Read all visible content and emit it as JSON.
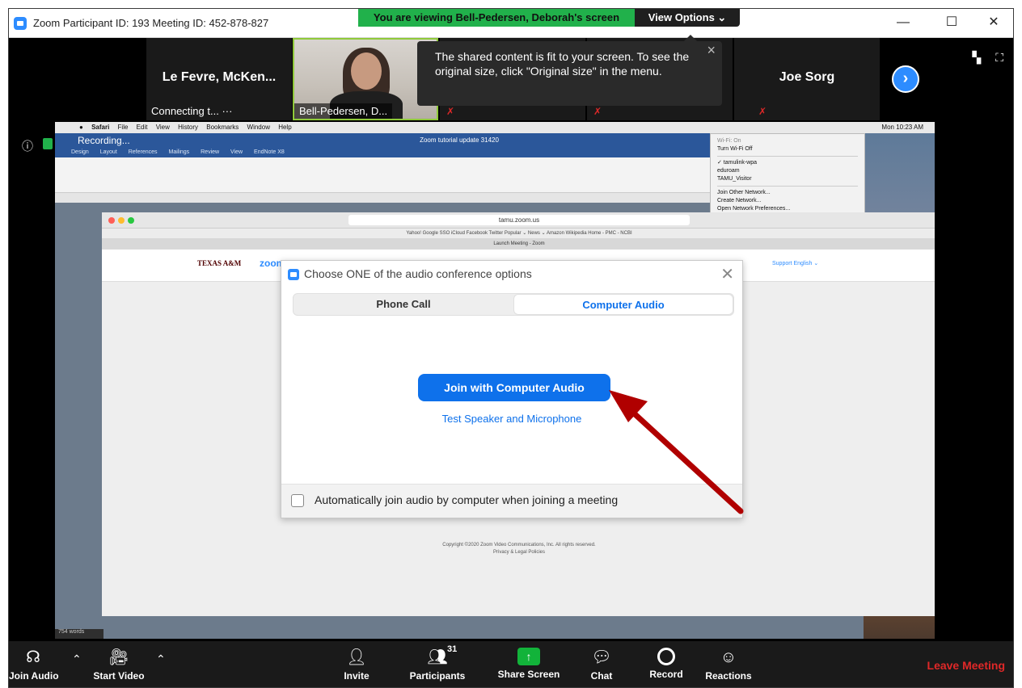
{
  "titlebar": {
    "title": "Zoom Participant ID: 193   Meeting ID: 452-878-827",
    "banner": "You are viewing Bell-Pedersen, Deborah's screen",
    "view_options": "View Options ⌄",
    "minimize": "—",
    "maximize": "☐",
    "close": "✕"
  },
  "strip": {
    "tile1_name": "Le Fevre, McKen...",
    "tile1_status": "Connecting t... ···",
    "tile2_label": "Bell-Pedersen, D...",
    "tile4_name": "Joe Sorg",
    "tooltip": "The shared content is fit to your screen. To see the original size, click \"Original size\" in the menu.",
    "next": "›"
  },
  "shared": {
    "recording": "Recording...",
    "mac_menu": [
      "Safari",
      "File",
      "Edit",
      "View",
      "History",
      "Bookmarks",
      "Window",
      "Help"
    ],
    "mac_time": "Mon 10:23 AM",
    "word_title": "Zoom tutorial update 31420",
    "word_tabs": [
      "Design",
      "Layout",
      "References",
      "Mailings",
      "Review",
      "View",
      "EndNote X8"
    ],
    "word_status": "754 words",
    "wifi": {
      "status": "Wi-Fi: On",
      "toggle": "Turn Wi-Fi Off",
      "networks": [
        "✓ tamulink-wpa",
        "eduroam",
        "TAMU_Visitor"
      ],
      "actions": [
        "Join Other Network...",
        "Create Network...",
        "Open Network Preferences..."
      ]
    },
    "url": "tamu.zoom.us",
    "bookmarks": "Yahoo!  Google  SSO  iCloud  Facebook  Twitter  Popular ⌄  News ⌄  Amazon  Wikipedia  Home - PMC - NCBI",
    "tab_title": "Launch Meeting - Zoom",
    "tamu_logo": "TEXAS A&M",
    "zoom_logo": "zoom",
    "page_links": "Support   English ⌄",
    "copyright_line1": "Copyright ©2020 Zoom Video Communications, Inc. All rights reserved.",
    "copyright_line2": "Privacy & Legal Policies"
  },
  "dialog": {
    "title": "Choose ONE of the audio conference options",
    "close": "✕",
    "tab_phone": "Phone Call",
    "tab_computer": "Computer Audio",
    "join_button": "Join with Computer Audio",
    "test_link": "Test Speaker and Microphone",
    "auto_join_label": "Automatically join audio by computer when joining a meeting"
  },
  "controls": {
    "join_audio": "Join Audio",
    "start_video": "Start Video",
    "invite": "Invite",
    "participants": "Participants",
    "participants_count": "31",
    "share_screen": "Share Screen",
    "chat": "Chat",
    "record": "Record",
    "reactions": "Reactions",
    "leave": "Leave Meeting"
  },
  "colors": {
    "zoom_blue": "#0e71eb",
    "banner_green": "#21b14b",
    "leave_red": "#e02828",
    "annotation_arrow": "#b00000"
  }
}
